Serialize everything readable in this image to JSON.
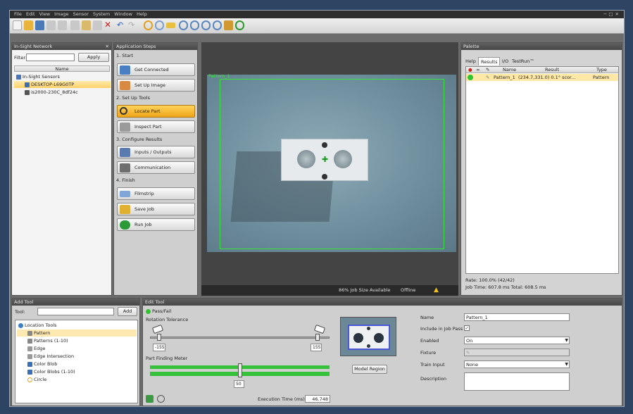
{
  "menu": [
    "File",
    "Edit",
    "View",
    "Image",
    "Sensor",
    "System",
    "Window",
    "Help"
  ],
  "network": {
    "title": "In-Sight Network",
    "filter_label": "Filter:",
    "apply": "Apply",
    "col": "Name",
    "root": "In-Sight Sensors",
    "items": [
      "DESKTOP-L69G0TP",
      "is2000-230C_8df24c"
    ]
  },
  "steps": {
    "title": "Application Steps",
    "s1": "1. Start",
    "get_connected": "Get Connected",
    "set_up_image": "Set Up Image",
    "s2": "2. Set Up Tools",
    "locate_part": "Locate Part",
    "inspect_part": "Inspect Part",
    "s3": "3. Configure Results",
    "inputs_outputs": "Inputs / Outputs",
    "communication": "Communication",
    "s4": "4. Finish",
    "filmstrip": "Filmstrip",
    "save_job": "Save Job",
    "run_job": "Run Job"
  },
  "image": {
    "pattern_label": "Pattern_1",
    "job_size": "86% Job Size Available",
    "status": "Offline"
  },
  "palette": {
    "title": "Palette",
    "tabs": [
      "Help",
      "Results",
      "I/O",
      "TestRun™"
    ],
    "cols": [
      "Name",
      "Result",
      "Type"
    ],
    "row": {
      "name": "Pattern_1",
      "result": "(234.7,331.0) 0.1° scor...",
      "type": "Pattern"
    },
    "rate": "Rate: 100.0% (42/42)",
    "timing": "Job Time: 607.8 ms  Total: 608.5 ms"
  },
  "addtool": {
    "title": "Add Tool",
    "tool_label": "Tool:",
    "add": "Add",
    "group": "Location Tools",
    "items": [
      "Pattern",
      "Patterns (1-10)",
      "Edge",
      "Edge Intersection",
      "Color Blob",
      "Color Blobs (1-10)",
      "Circle"
    ]
  },
  "edittool": {
    "title": "Edit Tool",
    "pass_fail": "Pass/Fail",
    "rotation": "Rotation Tolerance",
    "rot_min": "-155",
    "rot_max": "155",
    "meter": "Part Finding Meter",
    "meter_val": "50",
    "model_region": "Model Region",
    "exec_label": "Execution Time (ms)",
    "exec_val": "46.748",
    "name_label": "Name",
    "name_val": "Pattern_1",
    "include_label": "Include in Job Pass",
    "include_val": "✓",
    "enabled_label": "Enabled",
    "enabled_val": "On",
    "fixture_label": "Fixture",
    "train_label": "Train Input",
    "train_val": "None",
    "desc_label": "Description"
  }
}
